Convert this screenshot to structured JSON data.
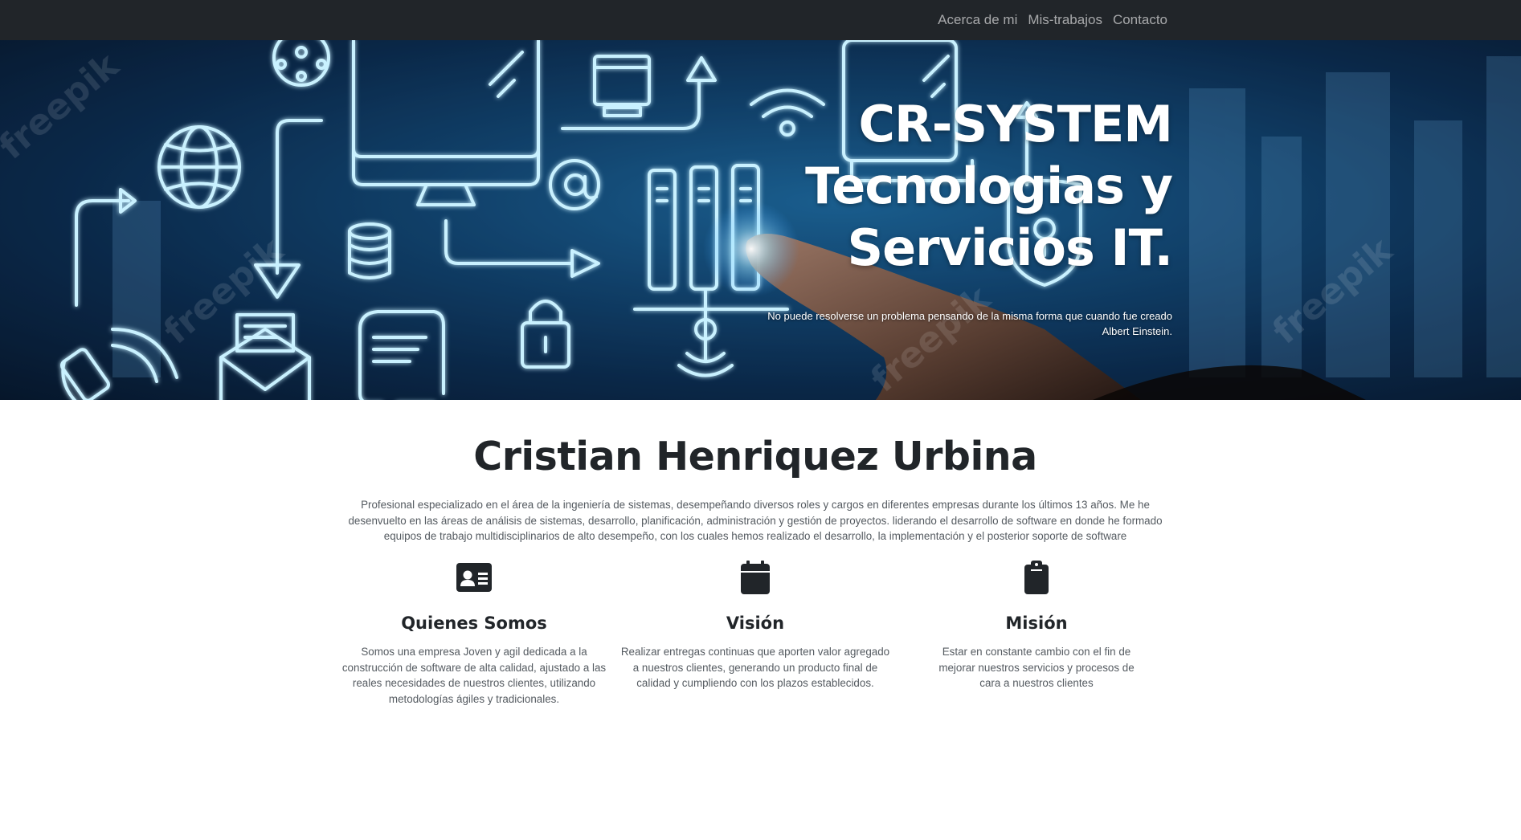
{
  "nav": {
    "links": [
      "Acerca de mi",
      "Mis-trabajos",
      "Contacto"
    ]
  },
  "hero": {
    "title_line1": "CR-SYSTEM",
    "title_line2": "Tecnologias y",
    "title_line3": "Servicios IT.",
    "quote": "No puede resolverse un problema pensando de la misma forma que cuando fue creado",
    "quote_author": "Albert Einstein.",
    "watermark": "freepik"
  },
  "about": {
    "name": "Cristian Henriquez Urbina",
    "description": "Profesional especializado en el área de la ingeniería de sistemas, desempeñando diversos roles y cargos en diferentes empresas durante los últimos 13 años. Me he desenvuelto en las áreas de análisis de sistemas, desarrollo, planificación, administración y gestión de proyectos. liderando el desarrollo de software en donde he formado equipos de trabajo multidisciplinarios de alto desempeño, con los cuales hemos realizado el desarrollo, la implementación y el posterior soporte de software"
  },
  "features": [
    {
      "icon": "id-card-icon",
      "title": "Quienes Somos",
      "text": "Somos una empresa Joven y agil dedicada a la construcción de software de alta calidad, ajustado a las reales necesidades de nuestros clientes, utilizando metodologías ágiles y tradicionales."
    },
    {
      "icon": "calendar-icon",
      "title": "Visión",
      "text": "Realizar entregas continuas que aporten valor agregado a nuestros clientes, generando un producto final de calidad y cumpliendo con los plazos establecidos."
    },
    {
      "icon": "clipboard-icon",
      "title": "Misión",
      "text": "Estar en constante cambio con el fin de mejorar nuestros servicios y procesos de cara a nuestros clientes"
    }
  ]
}
